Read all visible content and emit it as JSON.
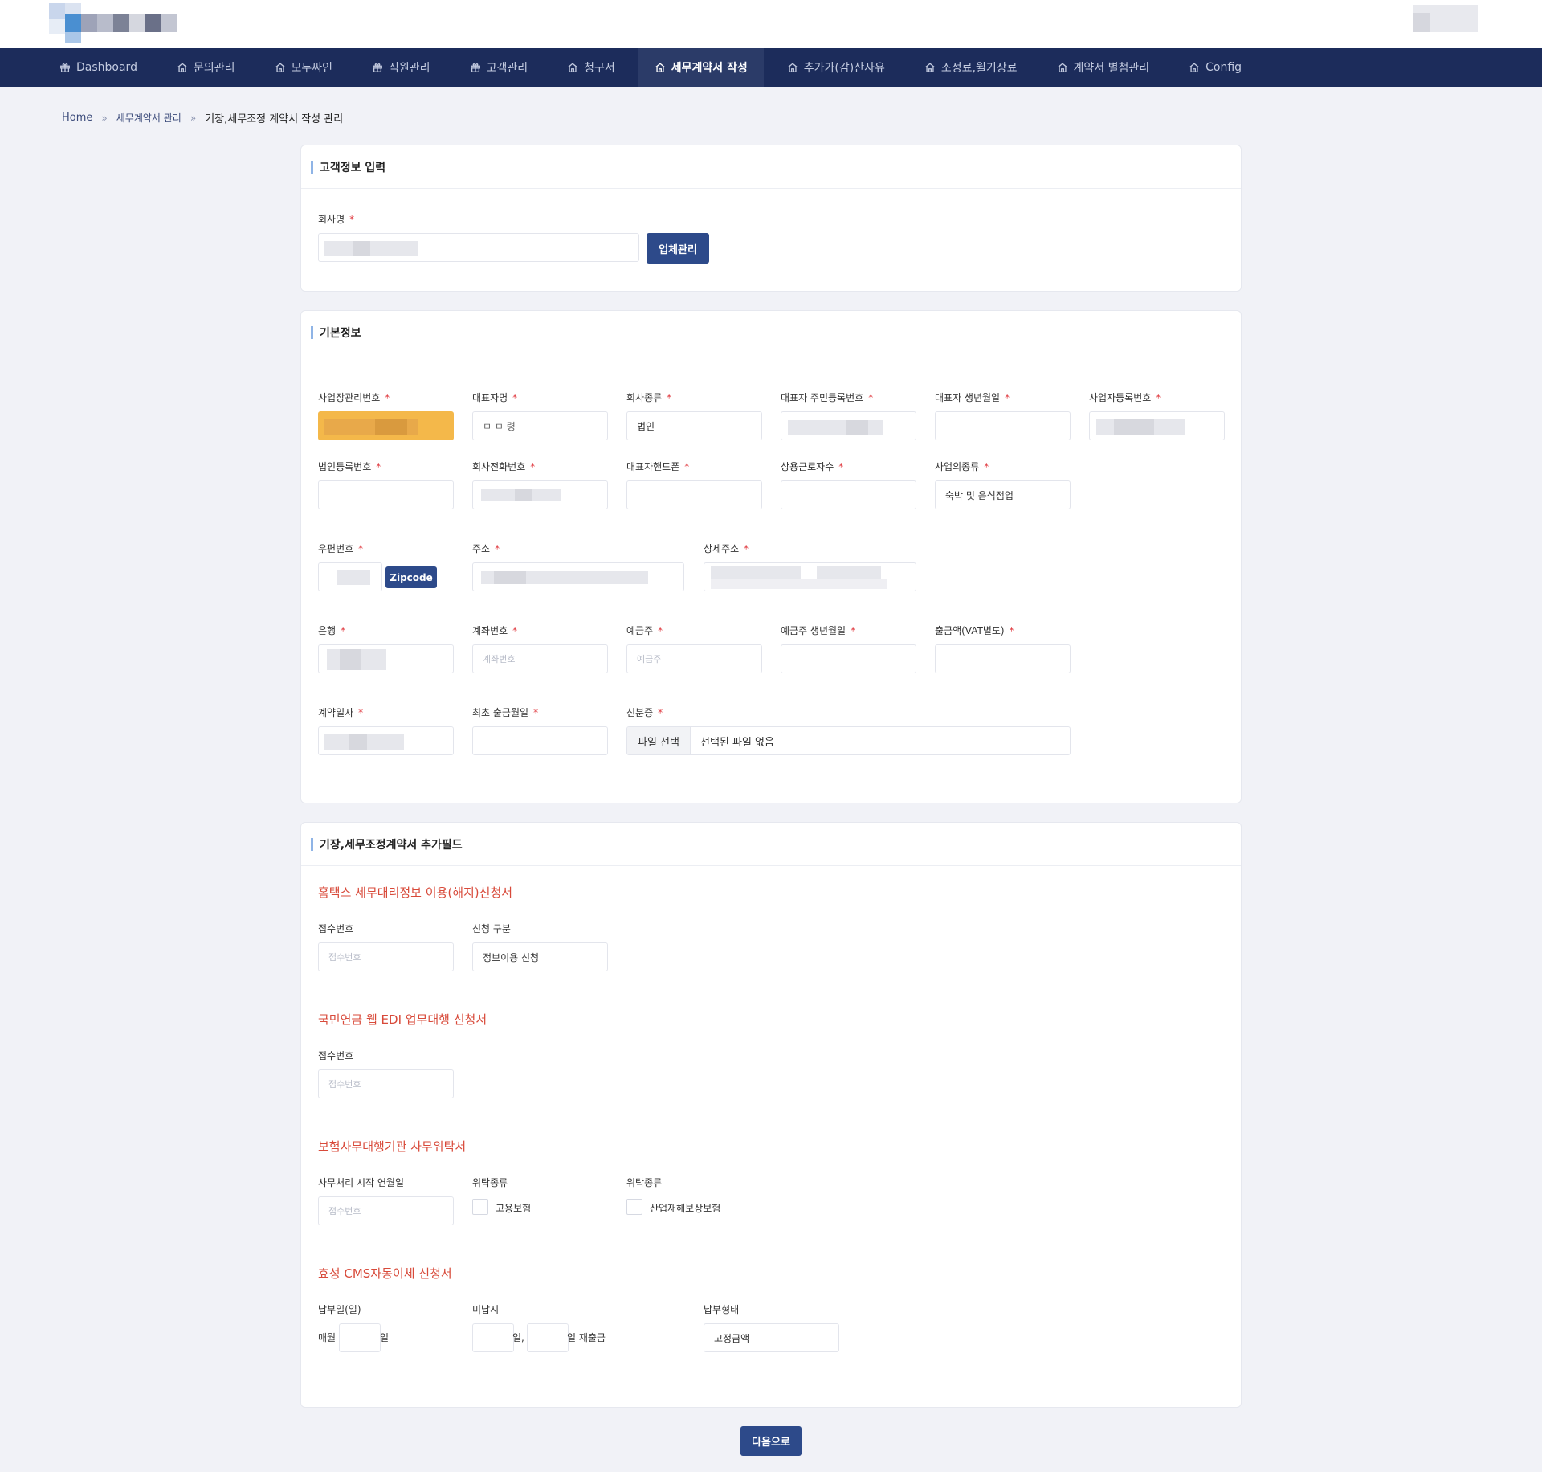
{
  "nav": {
    "items": [
      {
        "label": "Dashboard",
        "icon": "gift-icon",
        "name": "dashboard"
      },
      {
        "label": "문의관리",
        "icon": "home-icon",
        "name": "inquiry"
      },
      {
        "label": "모두싸인",
        "icon": "home-icon",
        "name": "modusign"
      },
      {
        "label": "직원관리",
        "icon": "gift-icon",
        "name": "staff"
      },
      {
        "label": "고객관리",
        "icon": "gift-icon",
        "name": "customer"
      },
      {
        "label": "청구서",
        "icon": "home-icon",
        "name": "invoice"
      },
      {
        "label": "세무계약서 작성",
        "icon": "home-icon",
        "name": "tax-contract",
        "active": true
      },
      {
        "label": "추가가(감)산사유",
        "icon": "home-icon",
        "name": "adjust-reason"
      },
      {
        "label": "조정료,월기장료",
        "icon": "home-icon",
        "name": "fees"
      },
      {
        "label": "계약서 별첨관리",
        "icon": "home-icon",
        "name": "attachments"
      },
      {
        "label": "Config",
        "icon": "home-icon",
        "name": "config"
      }
    ]
  },
  "breadcrumb": {
    "home": "Home",
    "level1": "세무계약서 관리",
    "current": "기장,세무조정 계약서 작성 관리",
    "sep": "»"
  },
  "customer": {
    "title": "고객정보 입력",
    "company_label": "회사명",
    "req": "*",
    "manage_button": "업체관리"
  },
  "basic": {
    "title": "기본정보",
    "labels": {
      "biz_mgmt_no": "사업장관리번호",
      "ceo_name": "대표자명",
      "company_type": "회사종류",
      "ceo_rrn": "대표자 주민등록번호",
      "ceo_birth": "대표자 생년월일",
      "biz_reg_no": "사업자등록번호",
      "corp_reg_no": "법인등록번호",
      "company_phone": "회사전화번호",
      "ceo_mobile": "대표자핸드폰",
      "employees": "상용근로자수",
      "biz_category": "사업의종류",
      "zipcode": "우편번호",
      "address": "주소",
      "address_detail": "상세주소",
      "bank": "은행",
      "account_no": "계좌번호",
      "depositor": "예금주",
      "depositor_birth": "예금주 생년월일",
      "withdraw_amount": "출금액(VAT별도)",
      "contract_date": "계약일자",
      "first_withdraw_date": "최초 출금월일",
      "id_card": "신분증"
    },
    "values": {
      "ceo_name_partial": "ㅁ ㅁ 령",
      "company_type": "법인",
      "biz_category": "숙박 및 음식점업"
    },
    "placeholders": {
      "account_no": "계좌번호",
      "depositor": "예금주"
    },
    "zipcode_button": "Zipcode",
    "file_button": "파일 선택",
    "file_none": "선택된 파일 없음"
  },
  "extra": {
    "title": "기장,세무조정계약서 추가필드",
    "hometax": {
      "title": "홈택스 세무대리정보 이용(해지)신청서",
      "receipt_label": "접수번호",
      "receipt_placeholder": "접수번호",
      "apply_type_label": "신청 구분",
      "apply_type_value": "정보이용 신청"
    },
    "pension": {
      "title": "국민연금 웹 EDI 업무대행 신청서",
      "receipt_label": "접수번호",
      "receipt_placeholder": "접수번호"
    },
    "insurance": {
      "title": "보험사무대행기관 사무위탁서",
      "start_label": "사무처리 시작 연월일",
      "start_placeholder": "접수번호",
      "type_label_1": "위탁종류",
      "type_label_2": "위탁종류",
      "employment": "고용보험",
      "industrial": "산업재해보상보험"
    },
    "cms": {
      "title": "효성 CMS자동이체 신청서",
      "payday_label": "납부일(일)",
      "monthly": "매월",
      "day": "일",
      "unpaid_label": "미납시",
      "day_comma": "일,",
      "rewithdraw": "일 재출금",
      "pay_type_label": "납부형태",
      "pay_type_value": "고정금액"
    }
  },
  "next_button": "다음으로",
  "colors": {
    "nav_bg": "#1c2c5b",
    "accent": "#2d4a8a",
    "highlight": "#f4b84a",
    "section_title": "#d84a3a",
    "required": "#e0383e"
  }
}
